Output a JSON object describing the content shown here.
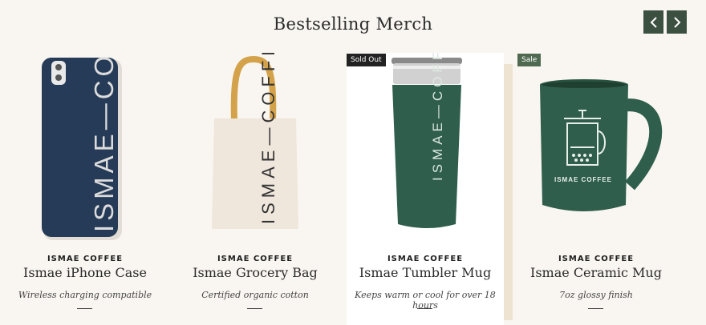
{
  "section": {
    "title": "Bestselling Merch",
    "prev_icon": "chevron-left-icon",
    "next_icon": "chevron-right-icon"
  },
  "colors": {
    "background": "#f9f6f1",
    "nav_button": "#3b5040",
    "product_green": "#2f5e4c",
    "phone_navy": "#263b57",
    "sale_badge": "#4f6a50",
    "soldout_badge": "#222222"
  },
  "products": [
    {
      "vendor": "ISMAE COFFEE",
      "name": "Ismae iPhone Case",
      "description": "Wireless charging compatible",
      "badge": "",
      "print_text": "ISMAE—COFFEE"
    },
    {
      "vendor": "ISMAE COFFEE",
      "name": "Ismae Grocery Bag",
      "description": "Certified organic cotton",
      "badge": "",
      "print_text": "ISMAE—COFFEE"
    },
    {
      "vendor": "ISMAE COFFEE",
      "name": "Ismae Tumbler Mug",
      "description": "Keeps warm or cool for over 18 hours",
      "badge": "Sold Out",
      "print_text": "ISMAE—COFFEE"
    },
    {
      "vendor": "ISMAE COFFEE",
      "name": "Ismae Ceramic Mug",
      "description": "7oz glossy finish",
      "badge": "Sale",
      "print_text": "ISMAE COFFEE"
    }
  ]
}
